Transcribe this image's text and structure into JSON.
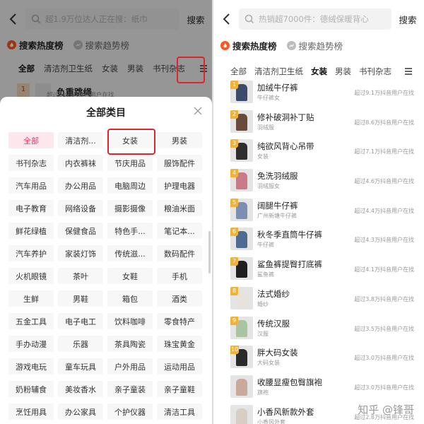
{
  "left": {
    "search_placeholder": "超1.9万位达人正在搜：纸巾",
    "search_button": "搜索",
    "rank_tabs": [
      "搜索热度榜",
      "搜索趋势榜"
    ],
    "categories_bar": [
      "全部",
      "清洁剂卫生纸",
      "女装",
      "男装",
      "书刊杂志"
    ],
    "behind_item": {
      "rank": "1",
      "name": "负重跳绳",
      "sub": "超过52.9万抖音用户在找"
    },
    "sheet": {
      "title": "全部类目",
      "categories": [
        "全部",
        "清洁剂...",
        "女装",
        "男装",
        "书刊杂志",
        "内衣裤袜",
        "节庆用品",
        "服饰配件",
        "汽车用品",
        "办公用品",
        "电脑周边",
        "护理电器",
        "电子教育",
        "网络设备",
        "摄影摄像",
        "粮油米面",
        "鲜花绿植",
        "保健食品",
        "特色手...",
        "笔记本...",
        "汽车养护",
        "家装灯饰",
        "传统滋...",
        "数码配件",
        "火机眼镜",
        "茶叶",
        "女鞋",
        "手机",
        "生鲜",
        "男鞋",
        "箱包",
        "酒类",
        "五金工具",
        "电子电工",
        "饮料咖啡",
        "零食特产",
        "手办动漫",
        "乐器",
        "茶具陶瓷",
        "珠宝黄金",
        "游戏电玩",
        "童车玩具",
        "户外用品",
        "运动用品",
        "奶粉辅食",
        "美妆香水",
        "亲子童装",
        "亲子童鞋",
        "烹饪用具",
        "办公家具",
        "个护仪器",
        "清洁工具"
      ],
      "selected_index": 0,
      "highlighted_index": 2
    }
  },
  "right": {
    "search_placeholder": "热销超7000件：德绒保暖背心",
    "search_button": "搜索",
    "rank_tabs": [
      "搜索热度榜",
      "搜索趋势榜"
    ],
    "categories_bar": [
      "全部",
      "清洁剂卫生纸",
      "女装",
      "男装",
      "书刊杂志"
    ],
    "active_category": "女装",
    "items": [
      {
        "rank": "1",
        "name": "加绒牛仔裤",
        "sub": "牛仔裤女",
        "stat": "超过9.1万抖音用户在找",
        "color": "#3c4a6b"
      },
      {
        "rank": "2",
        "name": "修补破洞补丁贴",
        "sub": "羽绒服",
        "stat": "超过8.6万抖音用户在找",
        "color": "#6a4a3a"
      },
      {
        "rank": "3",
        "name": "纯欲风背心吊带",
        "sub": "女装",
        "stat": "超过7.1万抖音用户在找",
        "color": "#2e2e2e"
      },
      {
        "rank": "4",
        "name": "免洗羽绒服",
        "sub": "羽绒服女",
        "stat": "超过4.6万抖音用户在找",
        "color": "#c97b8a"
      },
      {
        "rank": "5",
        "name": "阔腿牛仔裤",
        "sub": "广州新塘牛仔裤",
        "stat": "超过4.4万抖音用户在找",
        "color": "#7d8fb0"
      },
      {
        "rank": "6",
        "name": "秋冬季直筒牛仔裤",
        "sub": "牛仔裤",
        "stat": "超过4.3万抖音用户在找",
        "color": "#4e6b93"
      },
      {
        "rank": "7",
        "name": "鲨鱼裤提臀打底裤",
        "sub": "鲨鱼裤",
        "stat": "超过4.1万抖音用户在找",
        "color": "#1f1f1f"
      },
      {
        "rank": "8",
        "name": "法式婚纱",
        "sub": "婚纱",
        "stat": "超过3.8万抖音用户在找",
        "color": "#e7e2dc"
      },
      {
        "rank": "9",
        "name": "传统汉服",
        "sub": "汉服",
        "stat": "超过3.5万抖音用户在找",
        "color": "#a9c4a0"
      },
      {
        "rank": "10",
        "name": "胖大码女装",
        "sub": "大码女装",
        "stat": "超过3.0万抖音用户在找",
        "color": "#2a2a2a"
      },
      {
        "rank": "",
        "name": "收腰显瘦包臀旗袍",
        "sub": "旗袍",
        "stat": "超过3.0万抖音用户在找",
        "color": "#c9a99a"
      },
      {
        "rank": "",
        "name": "小香风新款外套",
        "sub": "小香风外套",
        "stat": "超过2.8万抖音用户在找",
        "color": "#d8cfc4"
      }
    ]
  },
  "watermark": "知乎 @锋哥",
  "colors": {
    "accent": "#ee3b6a",
    "hot": "#ff5722",
    "highlight_box": "#e0242e"
  }
}
